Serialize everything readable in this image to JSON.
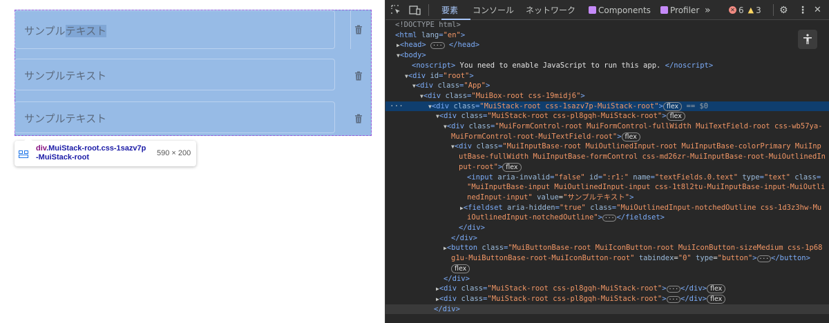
{
  "app": {
    "fields": [
      {
        "value": "サンプルテキスト",
        "selected_part": "テキスト",
        "plain_part": "サンプル"
      },
      {
        "value": "サンプルテキスト"
      },
      {
        "value": "サンプルテキスト"
      }
    ],
    "tooltip": {
      "tag": "div",
      "selector": ".MuiStack-root.css-1sazv7p",
      "selector_line2": "-MuiStack-root",
      "size": "590 × 200"
    },
    "highlight_color": "#6fa1dc"
  },
  "devtools": {
    "tabs": [
      {
        "label": "要素",
        "active": true
      },
      {
        "label": "コンソール"
      },
      {
        "label": "ネットワーク"
      },
      {
        "label": "Components"
      },
      {
        "label": "Profiler"
      }
    ],
    "more_tabs": "»",
    "errors": "6",
    "warnings": "3",
    "icons": [
      "inspect-element-icon",
      "device-toolbar-icon",
      "settings-icon",
      "more-vertical-icon",
      "close-icon",
      "accessibility-icon"
    ],
    "dom_lines": [
      {
        "text": "<!DOCTYPE html>"
      },
      {
        "text": "<html lang=\"en\">"
      },
      {
        "text": "<head> … </head>"
      },
      {
        "text": "<body>"
      },
      {
        "text": "<noscript> You need to enable JavaScript to run this app. </noscript>"
      },
      {
        "text": "<div id=\"root\">"
      },
      {
        "text": "<div class=\"App\">"
      },
      {
        "text": "<div class=\"MuiBox-root css-19midj6\">"
      },
      {
        "text": "<div class=\"MuiStack-root css-1sazv7p-MuiStack-root\"> flex == $0",
        "selected": true
      },
      {
        "text": "<div class=\"MuiStack-root css-pl8gqh-MuiStack-root\"> flex"
      },
      {
        "text": "<div class=\"MuiFormControl-root MuiFormControl-fullWidth MuiTextField-root css-wb57ya-MuiFormControl-root-MuiTextField-root\"> flex"
      },
      {
        "text": "<div class=\"MuiInputBase-root MuiOutlinedInput-root MuiInputBase-colorPrimary MuiInputBase-fullWidth MuiInputBase-formControl css-md26zr-MuiInputBase-root-MuiOutlinedInput-root\"> flex"
      },
      {
        "text": "<input aria-invalid=\"false\" id=\":r1:\" name=\"textFields.0.text\" type=\"text\" class=\"MuiInputBase-input MuiOutlinedInput-input css-1t8l2tu-MuiInputBase-input-MuiOutlinedInput-input\" value=\"サンプルテキスト\">"
      },
      {
        "text": "<fieldset aria-hidden=\"true\" class=\"MuiOutlinedInput-notchedOutline css-1d3z3hw-MuiOutlinedInput-notchedOutline\"> … </fieldset>"
      },
      {
        "text": "</div>"
      },
      {
        "text": "</div>"
      },
      {
        "text": "<button class=\"MuiButtonBase-root MuiIconButton-root MuiIconButton-sizeMedium css-1p68g1u-MuiButtonBase-root-MuiIconButton-root\" tabindex=\"0\" type=\"button\"> … </button> flex"
      },
      {
        "text": "</div>"
      },
      {
        "text": "<div class=\"MuiStack-root css-pl8gqh-MuiStack-root\"> … </div> flex"
      },
      {
        "text": "<div class=\"MuiStack-root css-pl8gqh-MuiStack-root\"> … </div> flex"
      },
      {
        "text": "</div>"
      }
    ]
  }
}
